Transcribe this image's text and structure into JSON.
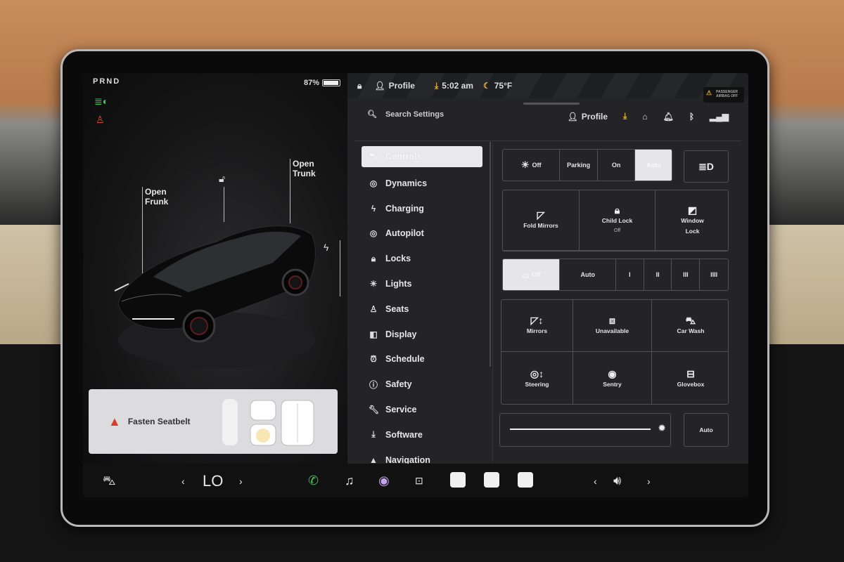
{
  "car": {
    "gear": "PRND",
    "battery_percent": "87%",
    "battery_level": 0.87,
    "open_frunk": [
      "Open",
      "Frunk"
    ],
    "open_trunk": [
      "Open",
      "Trunk"
    ],
    "seatbelt_alert": "Fasten Seatbelt"
  },
  "statusbar": {
    "profile": "Profile",
    "time": "5:02 am",
    "temperature": "75°F",
    "airbag_text": [
      "PASSENGER",
      "AIRBAG OFF"
    ]
  },
  "settings_header": {
    "search_placeholder": "Search Settings",
    "profile": "Profile"
  },
  "menu": [
    {
      "icon": "car-icon",
      "label": "Controls",
      "active": true
    },
    {
      "icon": "steering-wheel-icon",
      "label": "Dynamics"
    },
    {
      "icon": "bolt-icon",
      "label": "Charging"
    },
    {
      "icon": "steering-wheel-icon",
      "label": "Autopilot"
    },
    {
      "icon": "lock-icon",
      "label": "Locks"
    },
    {
      "icon": "sun-icon",
      "label": "Lights"
    },
    {
      "icon": "seat-icon",
      "label": "Seats"
    },
    {
      "icon": "display-icon",
      "label": "Display"
    },
    {
      "icon": "alarm-clock-icon",
      "label": "Schedule"
    },
    {
      "icon": "info-icon",
      "label": "Safety"
    },
    {
      "icon": "wrench-icon",
      "label": "Service"
    },
    {
      "icon": "download-icon",
      "label": "Software"
    },
    {
      "icon": "navigation-icon",
      "label": "Navigation"
    }
  ],
  "headlights": {
    "options": [
      "Off",
      "Parking",
      "On",
      "Auto"
    ],
    "selected": "Auto"
  },
  "quick_controls": {
    "fold_mirrors": "Fold Mirrors",
    "child_lock": "Child Lock",
    "child_lock_state": "Off",
    "window_lock": [
      "Window",
      "Lock"
    ]
  },
  "wipers": {
    "options": [
      "Off",
      "Auto",
      "I",
      "II",
      "III",
      "IIII"
    ],
    "selected": "Off"
  },
  "tiles": {
    "mirrors": "Mirrors",
    "unavailable": "Unavailable",
    "car_wash": "Car Wash",
    "steering": "Steering",
    "sentry": "Sentry",
    "glovebox": "Glovebox"
  },
  "brightness": {
    "level": 0.95,
    "auto_label": "Auto"
  },
  "bottom_bar": {
    "temperature": "LO"
  }
}
